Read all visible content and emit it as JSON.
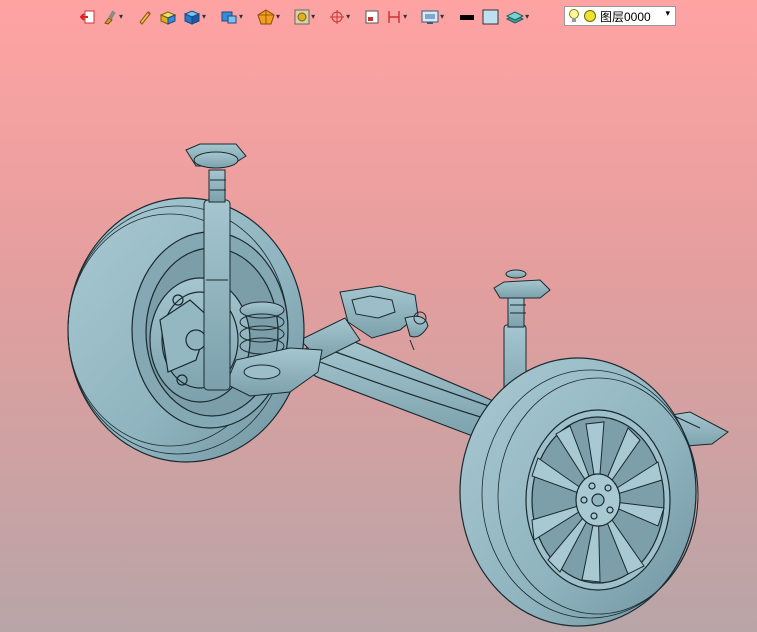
{
  "toolbar": {
    "buttons": [
      {
        "name": "exit-sketch-icon",
        "has_menu": false
      },
      {
        "name": "paint-brush-icon",
        "has_menu": true
      },
      {
        "name": "pencil-edit-icon",
        "has_menu": false
      },
      {
        "name": "solid-box-icon",
        "has_menu": false
      },
      {
        "name": "cube-view-icon",
        "has_menu": true
      },
      {
        "name": "standard-views-icon",
        "has_menu": true
      },
      {
        "name": "render-mode-icon",
        "has_menu": true
      },
      {
        "name": "section-view-icon",
        "has_menu": true
      },
      {
        "name": "coordinate-system-icon",
        "has_menu": true
      },
      {
        "name": "work-plane-icon",
        "has_menu": false
      },
      {
        "name": "dimension-icon",
        "has_menu": true
      },
      {
        "name": "display-filter-icon",
        "has_menu": true
      },
      {
        "name": "line-color-icon",
        "has_menu": false
      },
      {
        "name": "face-color-icon",
        "has_menu": false
      },
      {
        "name": "layers-icon",
        "has_menu": true
      }
    ]
  },
  "layer": {
    "current": "图层0000",
    "light_icon": "bulb-icon",
    "state_icon": "yellow-dot-icon"
  },
  "colors": {
    "bg_top": "#ffa3a3",
    "bg_bottom": "#b8a5a7",
    "model_fill": "#8fb4bf",
    "model_edge": "#1a2a30"
  },
  "viewport": {
    "model": "rear suspension assembly"
  }
}
